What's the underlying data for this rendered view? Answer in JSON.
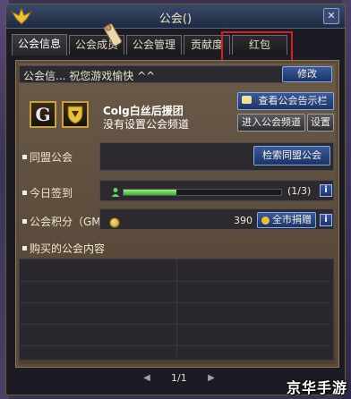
{
  "window": {
    "title": "公会()",
    "close_glyph": "✕"
  },
  "tabs": [
    {
      "label": "公会信息",
      "active": true
    },
    {
      "label": "公会成员",
      "active": false
    },
    {
      "label": "公会管理",
      "active": false
    },
    {
      "label": "贡献度",
      "active": false
    },
    {
      "label": "红包",
      "active": false
    }
  ],
  "notice": {
    "text": "公会信...  祝您游戏愉快 ^^",
    "edit_button": "修改"
  },
  "guild": {
    "icon_letter": "G",
    "name": "Colg白丝后援团",
    "subtitle": "没有设置公会频道",
    "board_button": "查看公会告示栏",
    "channel_button": "进入公会频道",
    "settings_button": "设置"
  },
  "alliance": {
    "label": "同盟公会",
    "search_button": "检索同盟公会"
  },
  "checkin": {
    "label": "今日签到",
    "progress_text": "(1/3)",
    "progress_fraction": 0.333,
    "info_glyph": "i"
  },
  "points": {
    "label": "公会积分（GM）",
    "value": "390",
    "donate_button": "全市捐赠",
    "info_glyph": "i"
  },
  "purchased": {
    "label": "购买的公会内容"
  },
  "pager": {
    "text": "1/1",
    "prev": "◀",
    "next": "▶"
  },
  "watermark": "京华手游",
  "colors": {
    "accent": "#3a5a9a",
    "panel": "#5a4a3a",
    "highlight_box": "#d42020"
  }
}
